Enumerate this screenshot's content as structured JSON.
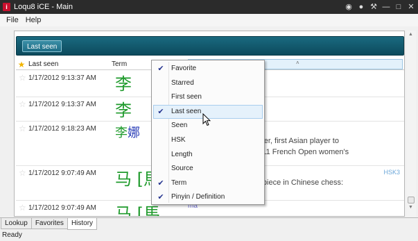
{
  "window": {
    "title": "Loqu8 iCE - Main",
    "icon_letter": "i"
  },
  "menubar": [
    "File",
    "Help"
  ],
  "banner": {
    "button_label": "Last seen"
  },
  "grid_header": {
    "last_seen": "Last seen",
    "term": "Term"
  },
  "rows": [
    {
      "time": "1/17/2012 9:13:37 AM",
      "term_g": "李",
      "term_b": ""
    },
    {
      "time": "1/17/2012 9:13:37 AM",
      "term_g": "李",
      "term_b": ""
    },
    {
      "time": "1/17/2012 9:18:23 AM",
      "term_g": "李",
      "term_b": "娜",
      "defn1": "e tennis player, first Asian player to",
      "defn2": "gles title (2011 French Open women's"
    },
    {
      "time": "1/17/2012 9:07:49 AM",
      "term_g": "马 [",
      "term_b": "",
      "term_g2": "馬",
      "tag": "HSK3",
      "defn1": "e or cavalry piece in Chinese chess:",
      "defn2": "ess"
    },
    {
      "time": "1/17/2012 9:07:49 AM",
      "term_g": "马 [",
      "term_b": "",
      "term_g2": "馬",
      "pinyin": "ma"
    }
  ],
  "context_menu": [
    {
      "label": "Favorite",
      "checked": true
    },
    {
      "label": "Starred",
      "checked": false
    },
    {
      "label": "First seen",
      "checked": false
    },
    {
      "label": "Last seen",
      "checked": true
    },
    {
      "label": "Seen",
      "checked": false
    },
    {
      "label": "HSK",
      "checked": false
    },
    {
      "label": "Length",
      "checked": false
    },
    {
      "label": "Source",
      "checked": false
    },
    {
      "label": "Term",
      "checked": true
    },
    {
      "label": "Pinyin / Definition",
      "checked": true
    }
  ],
  "tabs": [
    "Lookup",
    "Favorites",
    "History"
  ],
  "active_tab": "History",
  "status": "Ready",
  "colors": {
    "banner": "#0c4a5c",
    "term_green": "#1e9a2b",
    "term_blue": "#2b3fb8",
    "hsk_tag": "#6aa6d8"
  }
}
